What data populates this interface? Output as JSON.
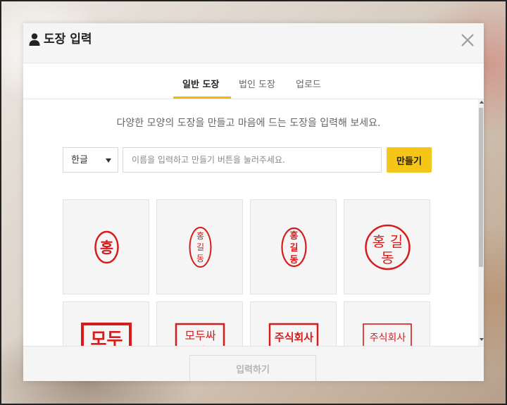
{
  "modal": {
    "title": "도장 입력",
    "close_icon": "close-icon",
    "person_icon": "person-icon"
  },
  "tabs": [
    {
      "label": "일반 도장",
      "active": true
    },
    {
      "label": "법인 도장",
      "active": false
    },
    {
      "label": "업로드",
      "active": false
    }
  ],
  "description": "다양한 모양의 도장을 만들고 마음에 드는 도장을 입력해 보세요.",
  "form": {
    "language_selected": "한글",
    "name_placeholder": "이름을 입력하고 만들기 버튼을 눌러주세요.",
    "name_value": "",
    "make_button": "만들기"
  },
  "stamps": [
    {
      "text": "홍",
      "shape": "oval"
    },
    {
      "text": "홍길동",
      "shape": "narrow-oval"
    },
    {
      "text": "홍길동",
      "shape": "oval"
    },
    {
      "text": "홍길동",
      "shape": "circle"
    },
    {
      "text": "모두",
      "shape": "square"
    },
    {
      "text": "모두싸인",
      "shape": "square"
    },
    {
      "text": "주식회사",
      "shape": "square"
    },
    {
      "text": "주식회사",
      "shape": "square"
    }
  ],
  "stamp_color": "#d81b1b",
  "accent_color": "#f5c518",
  "footer": {
    "submit_button": "입력하기"
  }
}
